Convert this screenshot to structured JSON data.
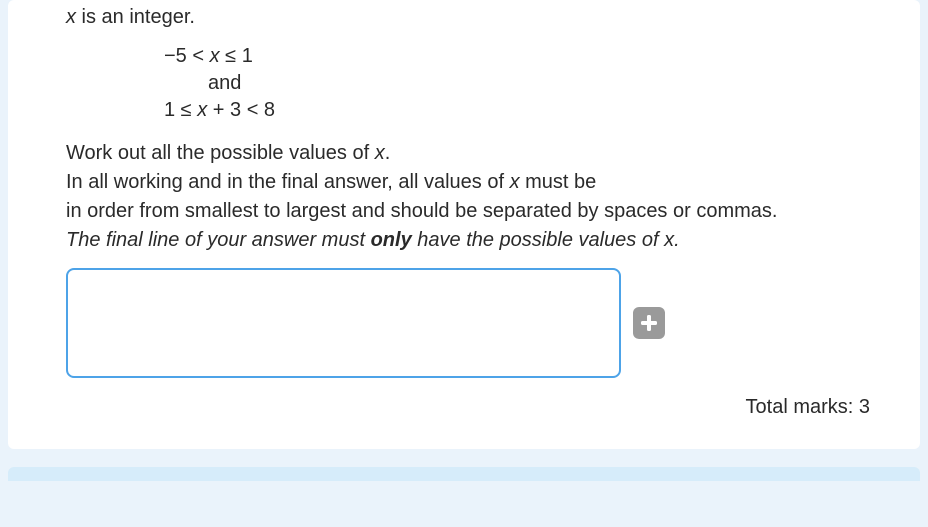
{
  "question": {
    "intro_prefix": "x",
    "intro_suffix": " is an integer.",
    "inequalities": {
      "line1_pre": "−5 < ",
      "line1_x": "x",
      "line1_post": " ≤ 1",
      "and": "and",
      "line2_pre": "1 ≤ ",
      "line2_x": "x",
      "line2_post": " + 3 < 8"
    },
    "instr1_pre": "Work out all the possible values of ",
    "instr1_x": "x",
    "instr1_post": ".",
    "instr2_pre": "In all working and in the final answer, all values of ",
    "instr2_x": "x",
    "instr2_post": " must be",
    "instr3": "in order from smallest to largest and should be separated by spaces or commas.",
    "final_pre": "The final line of your answer must ",
    "final_bold": "only",
    "final_post_a": " have the possible values of ",
    "final_x": "x",
    "final_post_b": "."
  },
  "answer": {
    "value": "",
    "placeholder": ""
  },
  "marks": {
    "label": "Total marks: 3"
  },
  "icons": {
    "plus": "plus-icon"
  }
}
